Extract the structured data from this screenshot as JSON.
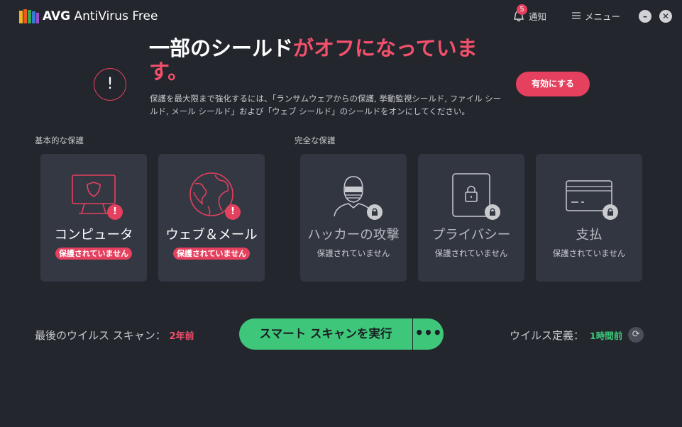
{
  "app": {
    "brand": "AVG",
    "product": "AntiVirus Free"
  },
  "header": {
    "notification_count": "5",
    "notification_label": "通知",
    "menu_label": "メニュー",
    "minimize_icon": "minimize-icon",
    "close_icon": "close-icon"
  },
  "alert": {
    "headline_white": "一部のシールド",
    "headline_red": "がオフになっています。",
    "description": "保護を最大限まで強化するには、「ランサムウェアからの保護, 挙動監視シールド, ファイル シールド, メール シールド」および「ウェブ シールド」のシールドをオンにしてください。",
    "enable_button": "有効にする"
  },
  "sections": {
    "basic": "基本的な保護",
    "full": "完全な保護"
  },
  "cards": [
    {
      "title": "コンピュータ",
      "status": "保護されていません",
      "icon": "computer-shield-icon",
      "state": "warning"
    },
    {
      "title": "ウェブ＆メール",
      "status": "保護されていません",
      "icon": "globe-icon",
      "state": "warning"
    },
    {
      "title": "ハッカーの攻撃",
      "status": "保護されていません",
      "icon": "hacker-icon",
      "state": "locked"
    },
    {
      "title": "プライバシー",
      "status": "保護されていません",
      "icon": "privacy-lock-icon",
      "state": "locked"
    },
    {
      "title": "支払",
      "status": "保護されていません",
      "icon": "credit-card-icon",
      "state": "locked"
    }
  ],
  "footer": {
    "last_scan_label": "最後のウイルス スキャン：",
    "last_scan_value": "2年前",
    "scan_button": "スマート スキャンを実行",
    "more_button": "•••",
    "definitions_label": "ウイルス定義：",
    "definitions_value": "1時間前"
  },
  "colors": {
    "background": "#23262d",
    "card": "#343843",
    "accent_red": "#e5405e",
    "accent_green": "#3ec77a"
  }
}
